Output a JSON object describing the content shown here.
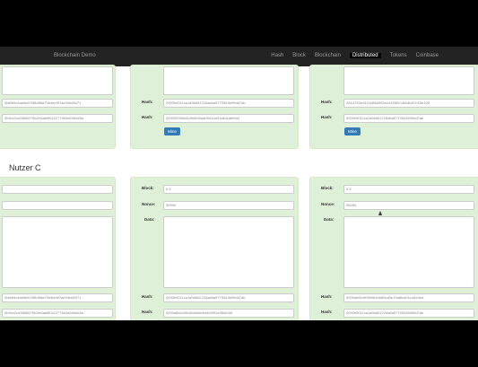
{
  "nav": {
    "brand": "Blockchain Demo",
    "links": [
      {
        "label": "Hash"
      },
      {
        "label": "Block"
      },
      {
        "label": "Blockchain"
      },
      {
        "label": "Distributed"
      },
      {
        "label": "Tokens"
      },
      {
        "label": "Coinbase"
      }
    ]
  },
  "top": {
    "left_hash": "0fa6b9c4ae6b670f8d98a79b4ee5f7ae93ed5471",
    "left_prev": "0b9ce2cd386657f0c2e6ab8f0c12775e5a006a45a",
    "mid_hash_label": "Hash:",
    "mid_hash": "0000b9011ca1a5b66122daa5a5779543b99dd7ab",
    "mid_prev_label": "Hash:",
    "mid_prev": "000000050e849e6fd0aab5d1da91c8d1afb5d4",
    "mine_label": "Mine",
    "right_hash_label": "Hash:",
    "right_hash": "281d733e4312e85a592eb4115f87c84db401f16e109",
    "right_prev_label": "Hash:",
    "right_prev": "0000b9011ca1a5b66122da5a5779543b99dd7ab"
  },
  "section_title": "Nutzer C",
  "row": {
    "block_label": "Block:",
    "block_mid": "# 4",
    "block_right": "# 5",
    "nonce_label": "Nonce:",
    "nonce_mid": "55990",
    "nonce_right": "56265",
    "data_label": "Data:",
    "hash_label": "Hash:",
    "prev_label": "Hash:",
    "left_hash": "0fa6b9c4ae6b670f8d98a79b4ee5f7ae93ed5471",
    "left_prev": "0b9ce2cd386657f0c2e6ab8f0c12775e5a006a45a",
    "mid_hash": "0000b9011ca1a5b66122daa5a5779543b99dd7ab",
    "mid_prev": "0000a6b0c96c8f40b8eb4d9df91e56ee3bf",
    "right_hash": "0000ae6b4e0fe9b44b80ea5e15a8fca01c45a3ea",
    "right_prev": "0000b9011ca1a5b66122da5a5779543b99dd7ab"
  }
}
